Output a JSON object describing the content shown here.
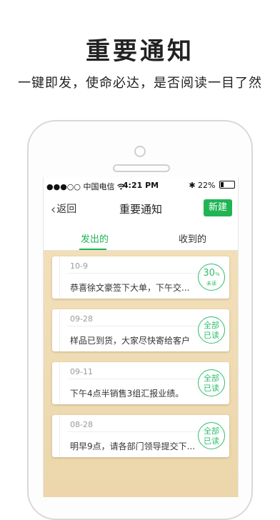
{
  "promo": {
    "title": "重要通知",
    "subtitle": "一键即发，使命必达，是否阅读一目了然"
  },
  "statusbar": {
    "carrier": "●●●○○ 中国电信 ",
    "wifi_icon": "wifi-icon",
    "time": "4:21 PM",
    "bluetooth": "✱",
    "battery_pct": "22%",
    "battery_level": 0.22
  },
  "navbar": {
    "back_label": "返回",
    "title": "重要通知",
    "new_label": "新建"
  },
  "tabs": {
    "sent": "发出的",
    "received": "收到的"
  },
  "cards": [
    {
      "date": "10-9",
      "message": "恭喜徐文豪签下大单，下午交...",
      "badge_num": "30",
      "badge_pct": "%",
      "badge_sub": "未读"
    },
    {
      "date": "09-28",
      "message": "样品已到货，大家尽快寄给客户",
      "badge_l1": "全部",
      "badge_l2": "已读"
    },
    {
      "date": "09-11",
      "message": "下午4点半销售3组汇报业绩。",
      "badge_l1": "全部",
      "badge_l2": "已读"
    },
    {
      "date": "08-28",
      "message": "明早9点，请各部门领导提交下...",
      "badge_l1": "全部",
      "badge_l2": "已读"
    }
  ],
  "colors": {
    "accent": "#1fb454",
    "background_wood": "#f0dcb4"
  }
}
